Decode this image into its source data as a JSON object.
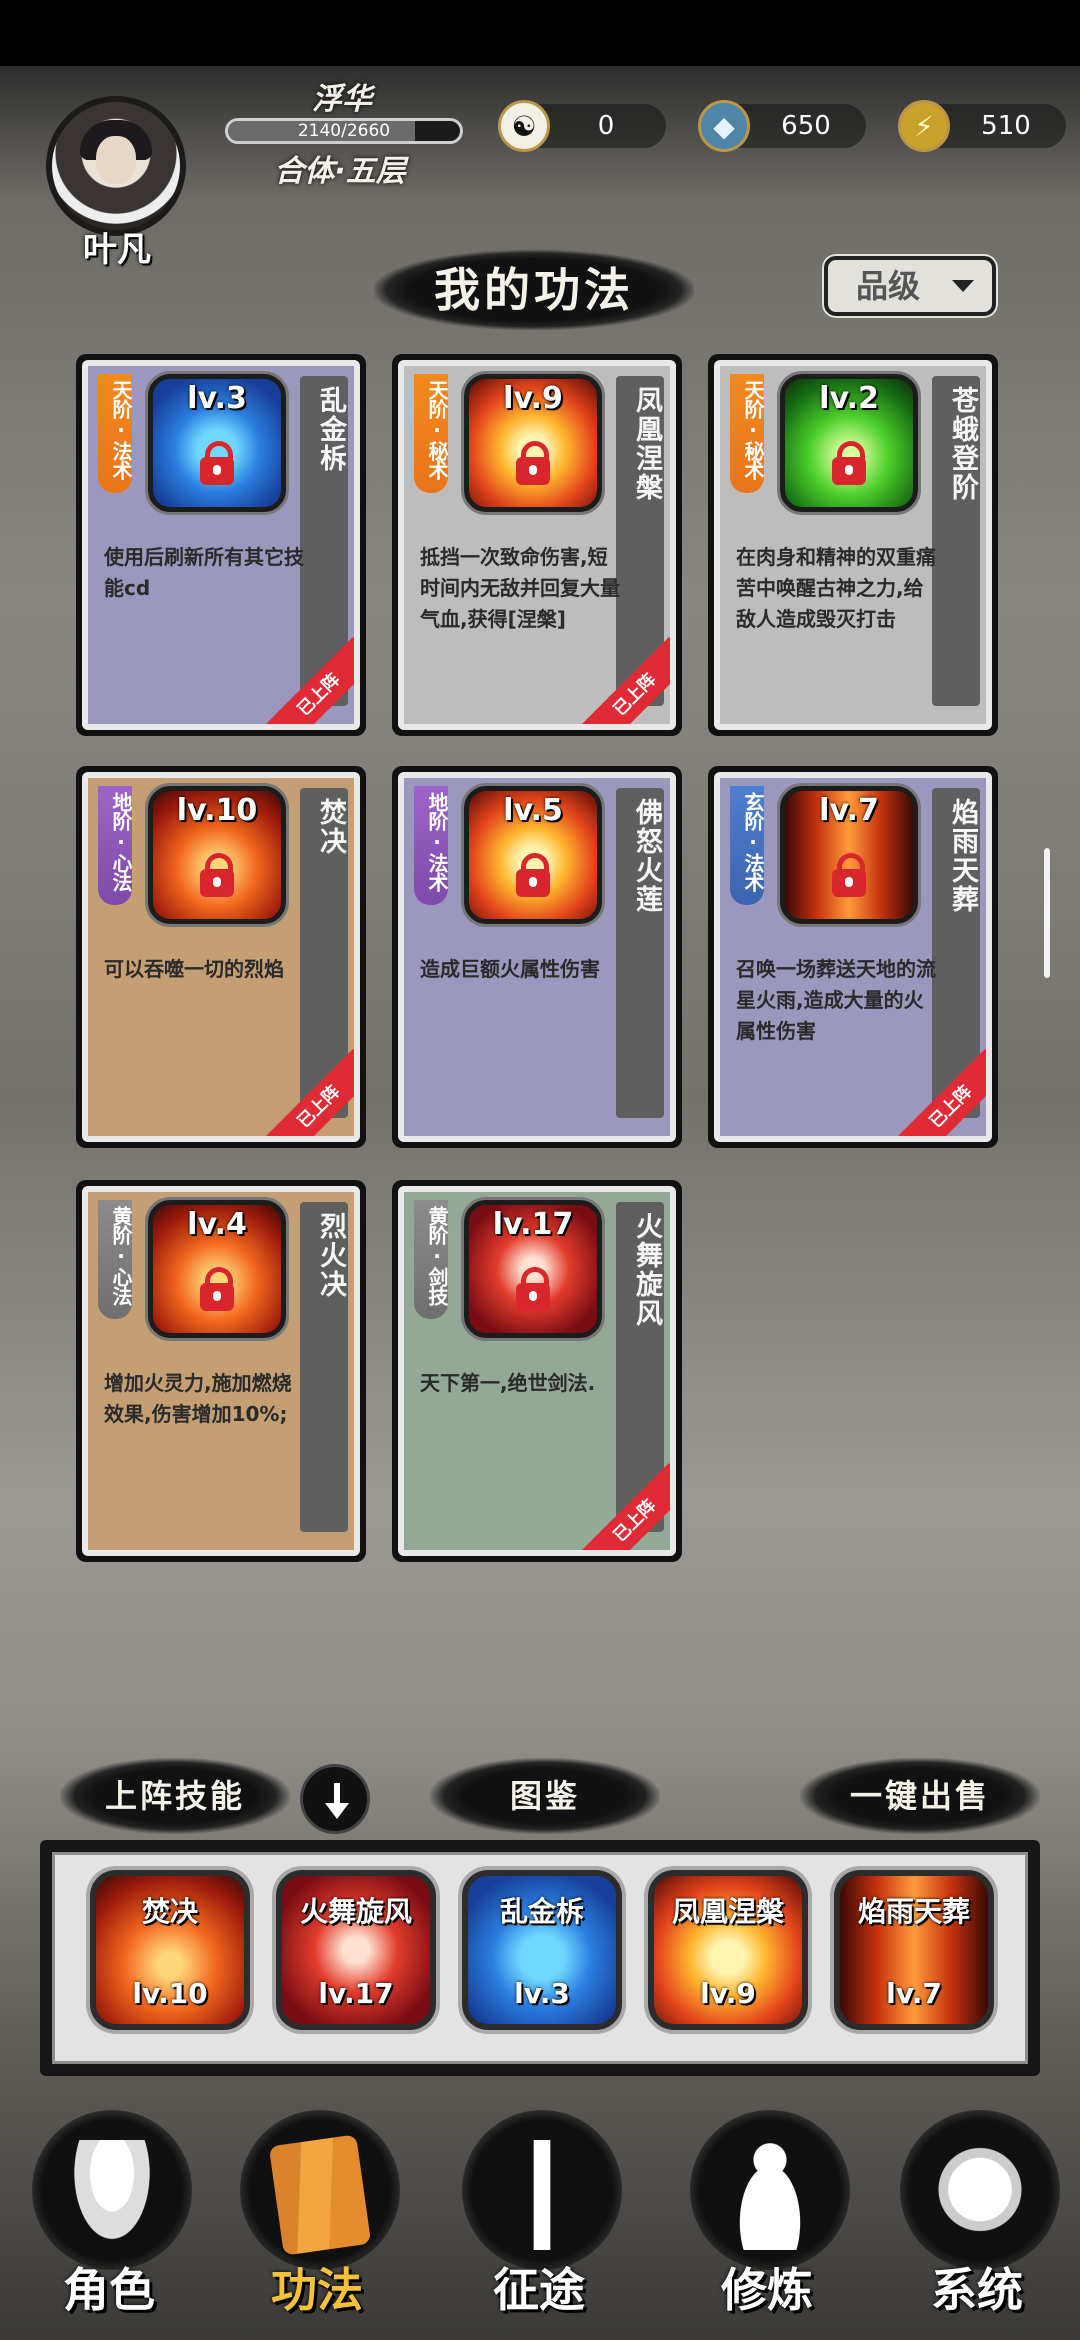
{
  "player": {
    "name": "叶凡",
    "realm_name": "浮华",
    "exp_text": "2140/2660",
    "exp_progress": 0.8045,
    "realm_level": "合体·五层"
  },
  "currencies": [
    {
      "icon": "yin-yang-icon",
      "value": "0"
    },
    {
      "icon": "spirit-stone-icon",
      "value": "650"
    },
    {
      "icon": "lightning-icon",
      "value": "510"
    }
  ],
  "page": {
    "title": "我的功法",
    "sort_label": "品级"
  },
  "cards": [
    {
      "grade": "天阶·法术",
      "level": "lv.3",
      "name": "乱金柝",
      "desc": "使用后刷新所有其它技能cd",
      "equipped": "已上阵"
    },
    {
      "grade": "天阶·秘术",
      "level": "lv.9",
      "name": "凤凰涅槃",
      "desc": "抵挡一次致命伤害,短时间内无敌并回复大量气血,获得[涅槃]",
      "equipped": "已上阵"
    },
    {
      "grade": "天阶·秘术",
      "level": "lv.2",
      "name": "苍蛾登阶",
      "desc": "在肉身和精神的双重痛苦中唤醒古神之力,给敌人造成毁灭打击",
      "equipped": ""
    },
    {
      "grade": "地阶·心法",
      "level": "lv.10",
      "name": "焚决",
      "desc": "可以吞噬一切的烈焰",
      "equipped": "已上阵"
    },
    {
      "grade": "地阶·法术",
      "level": "lv.5",
      "name": "佛怒火莲",
      "desc": "造成巨额火属性伤害",
      "equipped": ""
    },
    {
      "grade": "玄阶·法术",
      "level": "lv.7",
      "name": "焰雨天葬",
      "desc": "召唤一场葬送天地的流星火雨,造成大量的火属性伤害",
      "equipped": "已上阵"
    },
    {
      "grade": "黄阶·心法",
      "level": "lv.4",
      "name": "烈火决",
      "desc": "增加火灵力,施加燃烧效果,伤害增加10%;",
      "equipped": ""
    },
    {
      "grade": "黄阶·剑技",
      "level": "lv.17",
      "name": "火舞旋风",
      "desc": "天下第一,绝世剑法.",
      "equipped": "已上阵"
    }
  ],
  "lineup": {
    "label": "上阵技能",
    "codex_label": "图鉴",
    "sell_label": "一键出售",
    "slots": [
      {
        "name": "焚决",
        "level": "lv.10"
      },
      {
        "name": "火舞旋风",
        "level": "lv.17"
      },
      {
        "name": "乱金柝",
        "level": "lv.3"
      },
      {
        "name": "凤凰涅槃",
        "level": "lv.9"
      },
      {
        "name": "焰雨天葬",
        "level": "lv.7"
      }
    ]
  },
  "nav": [
    {
      "label": "角色",
      "icon": "hooded-character-icon"
    },
    {
      "label": "功法",
      "icon": "skill-books-icon"
    },
    {
      "label": "征途",
      "icon": "sword-emblem-icon"
    },
    {
      "label": "修炼",
      "icon": "meditating-figure-icon"
    },
    {
      "label": "系统",
      "icon": "system-girl-icon"
    }
  ]
}
